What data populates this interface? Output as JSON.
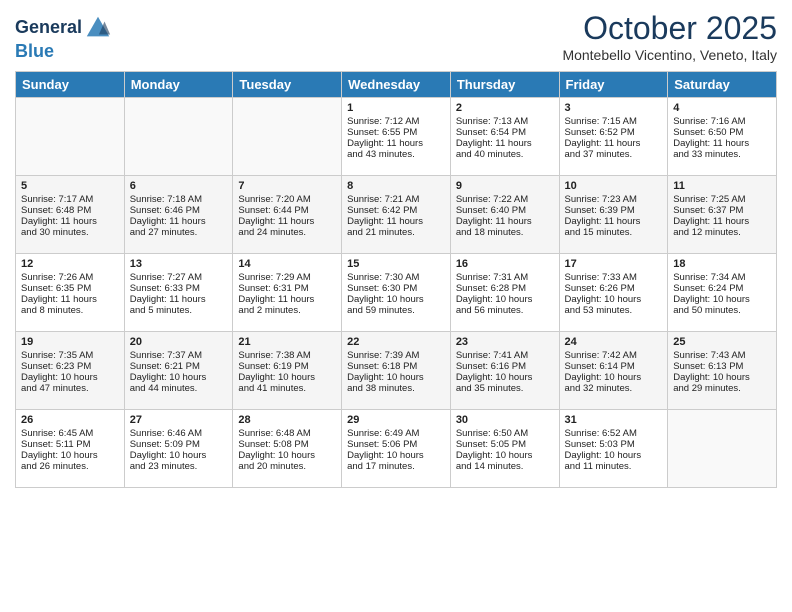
{
  "header": {
    "logo_line1": "General",
    "logo_line2": "Blue",
    "month": "October 2025",
    "location": "Montebello Vicentino, Veneto, Italy"
  },
  "days_of_week": [
    "Sunday",
    "Monday",
    "Tuesday",
    "Wednesday",
    "Thursday",
    "Friday",
    "Saturday"
  ],
  "weeks": [
    [
      {
        "day": "",
        "content": ""
      },
      {
        "day": "",
        "content": ""
      },
      {
        "day": "",
        "content": ""
      },
      {
        "day": "1",
        "content": "Sunrise: 7:12 AM\nSunset: 6:55 PM\nDaylight: 11 hours\nand 43 minutes."
      },
      {
        "day": "2",
        "content": "Sunrise: 7:13 AM\nSunset: 6:54 PM\nDaylight: 11 hours\nand 40 minutes."
      },
      {
        "day": "3",
        "content": "Sunrise: 7:15 AM\nSunset: 6:52 PM\nDaylight: 11 hours\nand 37 minutes."
      },
      {
        "day": "4",
        "content": "Sunrise: 7:16 AM\nSunset: 6:50 PM\nDaylight: 11 hours\nand 33 minutes."
      }
    ],
    [
      {
        "day": "5",
        "content": "Sunrise: 7:17 AM\nSunset: 6:48 PM\nDaylight: 11 hours\nand 30 minutes."
      },
      {
        "day": "6",
        "content": "Sunrise: 7:18 AM\nSunset: 6:46 PM\nDaylight: 11 hours\nand 27 minutes."
      },
      {
        "day": "7",
        "content": "Sunrise: 7:20 AM\nSunset: 6:44 PM\nDaylight: 11 hours\nand 24 minutes."
      },
      {
        "day": "8",
        "content": "Sunrise: 7:21 AM\nSunset: 6:42 PM\nDaylight: 11 hours\nand 21 minutes."
      },
      {
        "day": "9",
        "content": "Sunrise: 7:22 AM\nSunset: 6:40 PM\nDaylight: 11 hours\nand 18 minutes."
      },
      {
        "day": "10",
        "content": "Sunrise: 7:23 AM\nSunset: 6:39 PM\nDaylight: 11 hours\nand 15 minutes."
      },
      {
        "day": "11",
        "content": "Sunrise: 7:25 AM\nSunset: 6:37 PM\nDaylight: 11 hours\nand 12 minutes."
      }
    ],
    [
      {
        "day": "12",
        "content": "Sunrise: 7:26 AM\nSunset: 6:35 PM\nDaylight: 11 hours\nand 8 minutes."
      },
      {
        "day": "13",
        "content": "Sunrise: 7:27 AM\nSunset: 6:33 PM\nDaylight: 11 hours\nand 5 minutes."
      },
      {
        "day": "14",
        "content": "Sunrise: 7:29 AM\nSunset: 6:31 PM\nDaylight: 11 hours\nand 2 minutes."
      },
      {
        "day": "15",
        "content": "Sunrise: 7:30 AM\nSunset: 6:30 PM\nDaylight: 10 hours\nand 59 minutes."
      },
      {
        "day": "16",
        "content": "Sunrise: 7:31 AM\nSunset: 6:28 PM\nDaylight: 10 hours\nand 56 minutes."
      },
      {
        "day": "17",
        "content": "Sunrise: 7:33 AM\nSunset: 6:26 PM\nDaylight: 10 hours\nand 53 minutes."
      },
      {
        "day": "18",
        "content": "Sunrise: 7:34 AM\nSunset: 6:24 PM\nDaylight: 10 hours\nand 50 minutes."
      }
    ],
    [
      {
        "day": "19",
        "content": "Sunrise: 7:35 AM\nSunset: 6:23 PM\nDaylight: 10 hours\nand 47 minutes."
      },
      {
        "day": "20",
        "content": "Sunrise: 7:37 AM\nSunset: 6:21 PM\nDaylight: 10 hours\nand 44 minutes."
      },
      {
        "day": "21",
        "content": "Sunrise: 7:38 AM\nSunset: 6:19 PM\nDaylight: 10 hours\nand 41 minutes."
      },
      {
        "day": "22",
        "content": "Sunrise: 7:39 AM\nSunset: 6:18 PM\nDaylight: 10 hours\nand 38 minutes."
      },
      {
        "day": "23",
        "content": "Sunrise: 7:41 AM\nSunset: 6:16 PM\nDaylight: 10 hours\nand 35 minutes."
      },
      {
        "day": "24",
        "content": "Sunrise: 7:42 AM\nSunset: 6:14 PM\nDaylight: 10 hours\nand 32 minutes."
      },
      {
        "day": "25",
        "content": "Sunrise: 7:43 AM\nSunset: 6:13 PM\nDaylight: 10 hours\nand 29 minutes."
      }
    ],
    [
      {
        "day": "26",
        "content": "Sunrise: 6:45 AM\nSunset: 5:11 PM\nDaylight: 10 hours\nand 26 minutes."
      },
      {
        "day": "27",
        "content": "Sunrise: 6:46 AM\nSunset: 5:09 PM\nDaylight: 10 hours\nand 23 minutes."
      },
      {
        "day": "28",
        "content": "Sunrise: 6:48 AM\nSunset: 5:08 PM\nDaylight: 10 hours\nand 20 minutes."
      },
      {
        "day": "29",
        "content": "Sunrise: 6:49 AM\nSunset: 5:06 PM\nDaylight: 10 hours\nand 17 minutes."
      },
      {
        "day": "30",
        "content": "Sunrise: 6:50 AM\nSunset: 5:05 PM\nDaylight: 10 hours\nand 14 minutes."
      },
      {
        "day": "31",
        "content": "Sunrise: 6:52 AM\nSunset: 5:03 PM\nDaylight: 10 hours\nand 11 minutes."
      },
      {
        "day": "",
        "content": ""
      }
    ]
  ]
}
